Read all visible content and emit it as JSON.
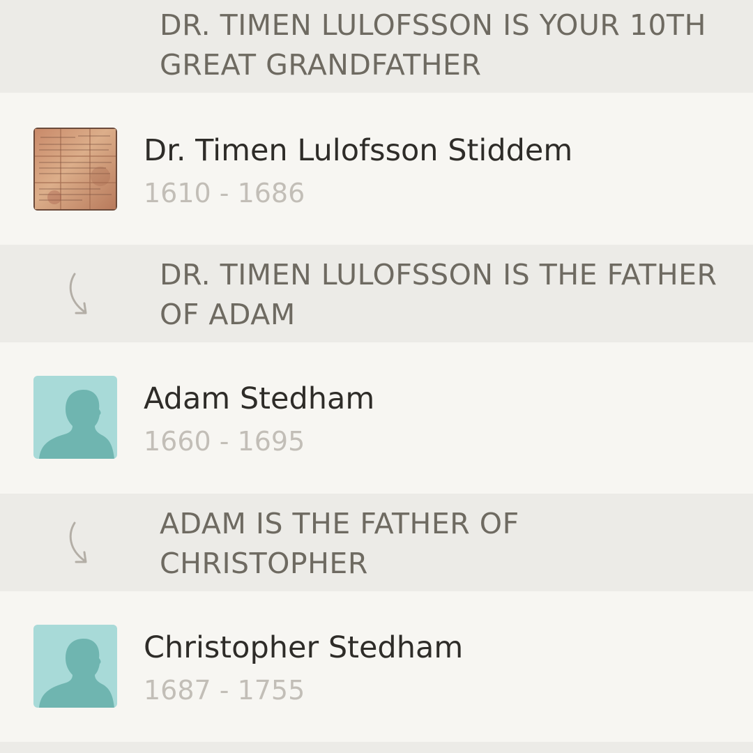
{
  "header": {
    "relationship": "DR. TIMEN LULOFSSON IS YOUR 10TH\nGREAT GRANDFATHER"
  },
  "people": [
    {
      "name": "Dr. Timen Lulofsson Stiddem",
      "dates": "1610 - 1686",
      "photo": "document-photo"
    },
    {
      "name": "Adam Stedham",
      "dates": "1660 - 1695",
      "photo": "silhouette-placeholder"
    },
    {
      "name": "Christopher Stedham",
      "dates": "1687 - 1755",
      "photo": "silhouette-placeholder"
    }
  ],
  "links": [
    {
      "relationship": "DR. TIMEN LULOFSSON IS THE FATHER\nOF ADAM",
      "icon": "curved-arrow-down-icon"
    },
    {
      "relationship": "ADAM IS THE FATHER OF\nCHRISTOPHER",
      "icon": "curved-arrow-down-icon"
    }
  ],
  "colors": {
    "band_background": "#ecebe7",
    "row_background": "#f7f6f2",
    "relationship_text": "#6e6a61",
    "name_text": "#2e2c28",
    "dates_text": "#c2beb7",
    "avatar_background": "#a8dad8",
    "avatar_silhouette": "#6fb5b0"
  }
}
